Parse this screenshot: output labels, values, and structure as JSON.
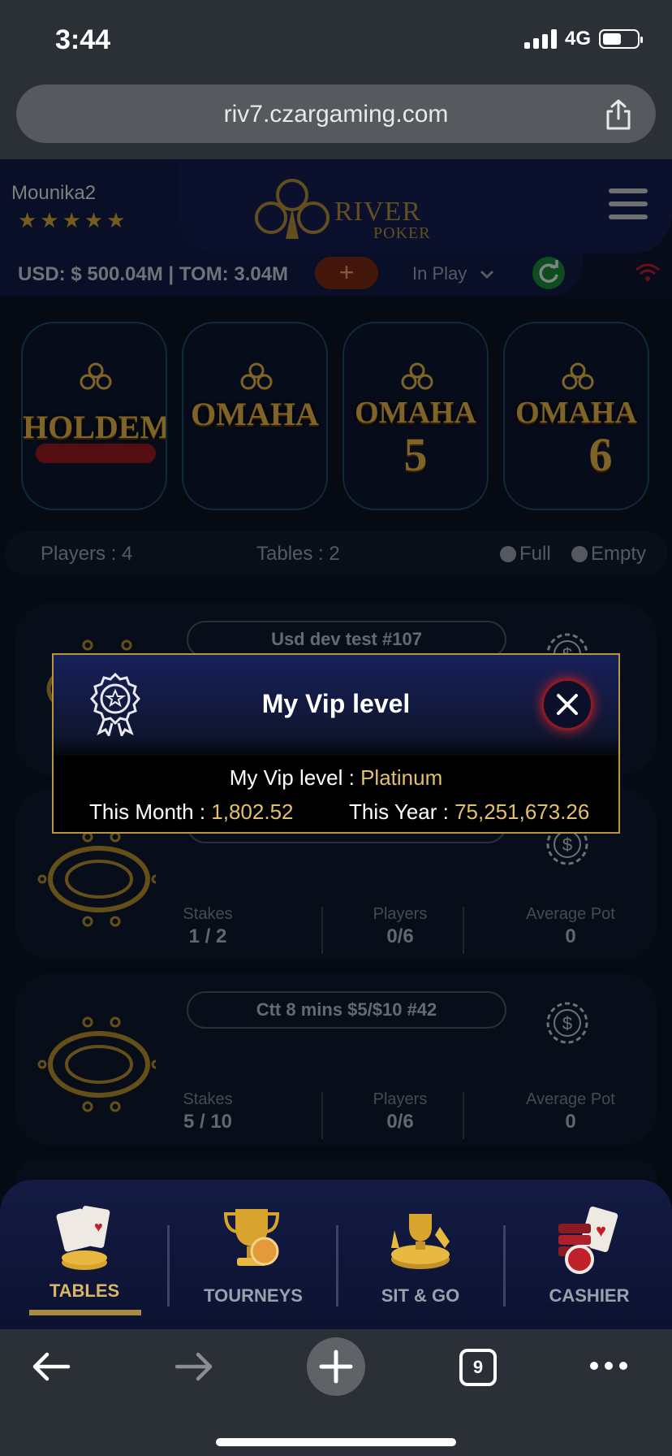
{
  "status_bar": {
    "time": "3:44",
    "network": "4G"
  },
  "browser": {
    "url": "riv7.czargaming.com",
    "tab_count": "9"
  },
  "header": {
    "username": "Mounika2",
    "stars": "★★★★★",
    "logo_text": "RIVER",
    "logo_sub": "POKER",
    "balance": "USD: $ 500.04M | TOM: 3.04M",
    "add_label": "+",
    "filter_select": "In Play"
  },
  "games": [
    {
      "label": "HOLDEM",
      "num": ""
    },
    {
      "label": "OMAHA",
      "num": ""
    },
    {
      "label": "OMAHA",
      "num": "5"
    },
    {
      "label": "OMAHA",
      "num": "6"
    }
  ],
  "filters": {
    "players": "Players : 4",
    "tables": "Tables : 2",
    "full": "Full",
    "empty": "Empty"
  },
  "tables": [
    {
      "name": "Usd dev test #107",
      "stakes_label": "",
      "stakes": "",
      "players_label": "",
      "players": "",
      "pot_label": "",
      "pot": ""
    },
    {
      "name": "",
      "stakes_label": "Stakes",
      "stakes": "1 / 2",
      "players_label": "Players",
      "players": "0/6",
      "pot_label": "Average Pot",
      "pot": "0"
    },
    {
      "name": "Ctt 8 mins $5/$10 #42",
      "stakes_label": "Stakes",
      "stakes": "5 / 10",
      "players_label": "Players",
      "players": "0/6",
      "pot_label": "Average Pot",
      "pot": "0"
    }
  ],
  "modal": {
    "title": "My Vip level",
    "vip_label": "My Vip level : ",
    "vip_value": "Platinum",
    "month_label": "This Month : ",
    "month_value": "1,802.52",
    "year_label": "This Year : ",
    "year_value": "75,251,673.26"
  },
  "bottom_nav": [
    {
      "label": "TABLES",
      "active": true
    },
    {
      "label": "TOURNEYS",
      "active": false
    },
    {
      "label": "SIT & GO",
      "active": false
    },
    {
      "label": "CASHIER",
      "active": false
    }
  ],
  "colors": {
    "gold": "#e2c06c",
    "accent_red": "#b0202a",
    "bg": "#0b1322"
  }
}
